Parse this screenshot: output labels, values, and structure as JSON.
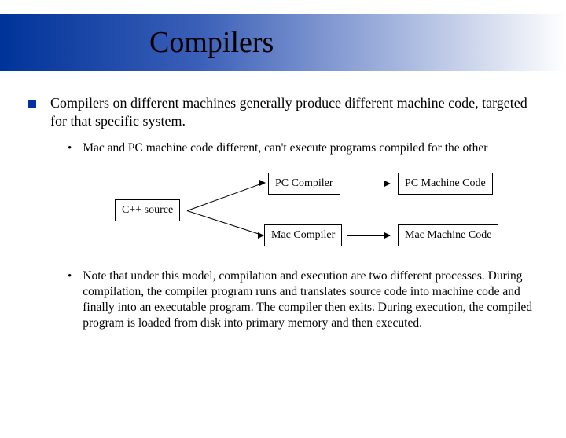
{
  "title": "Compilers",
  "main_bullet": "Compilers on different machines generally produce different machine code, targeted for that specific system.",
  "sub1": "Mac and PC machine code different, can't execute programs compiled for the other",
  "sub2": "Note that under this model, compilation and execution are two different processes. During compilation, the compiler program runs and translates source code into machine code and finally into an executable program.  The compiler then exits. During execution, the compiled program is loaded from disk into primary memory and then executed.",
  "diagram": {
    "source": "C++ source",
    "comp1": "PC Compiler",
    "comp2": "Mac Compiler",
    "out1": "PC Machine Code",
    "out2": "Mac Machine Code"
  }
}
